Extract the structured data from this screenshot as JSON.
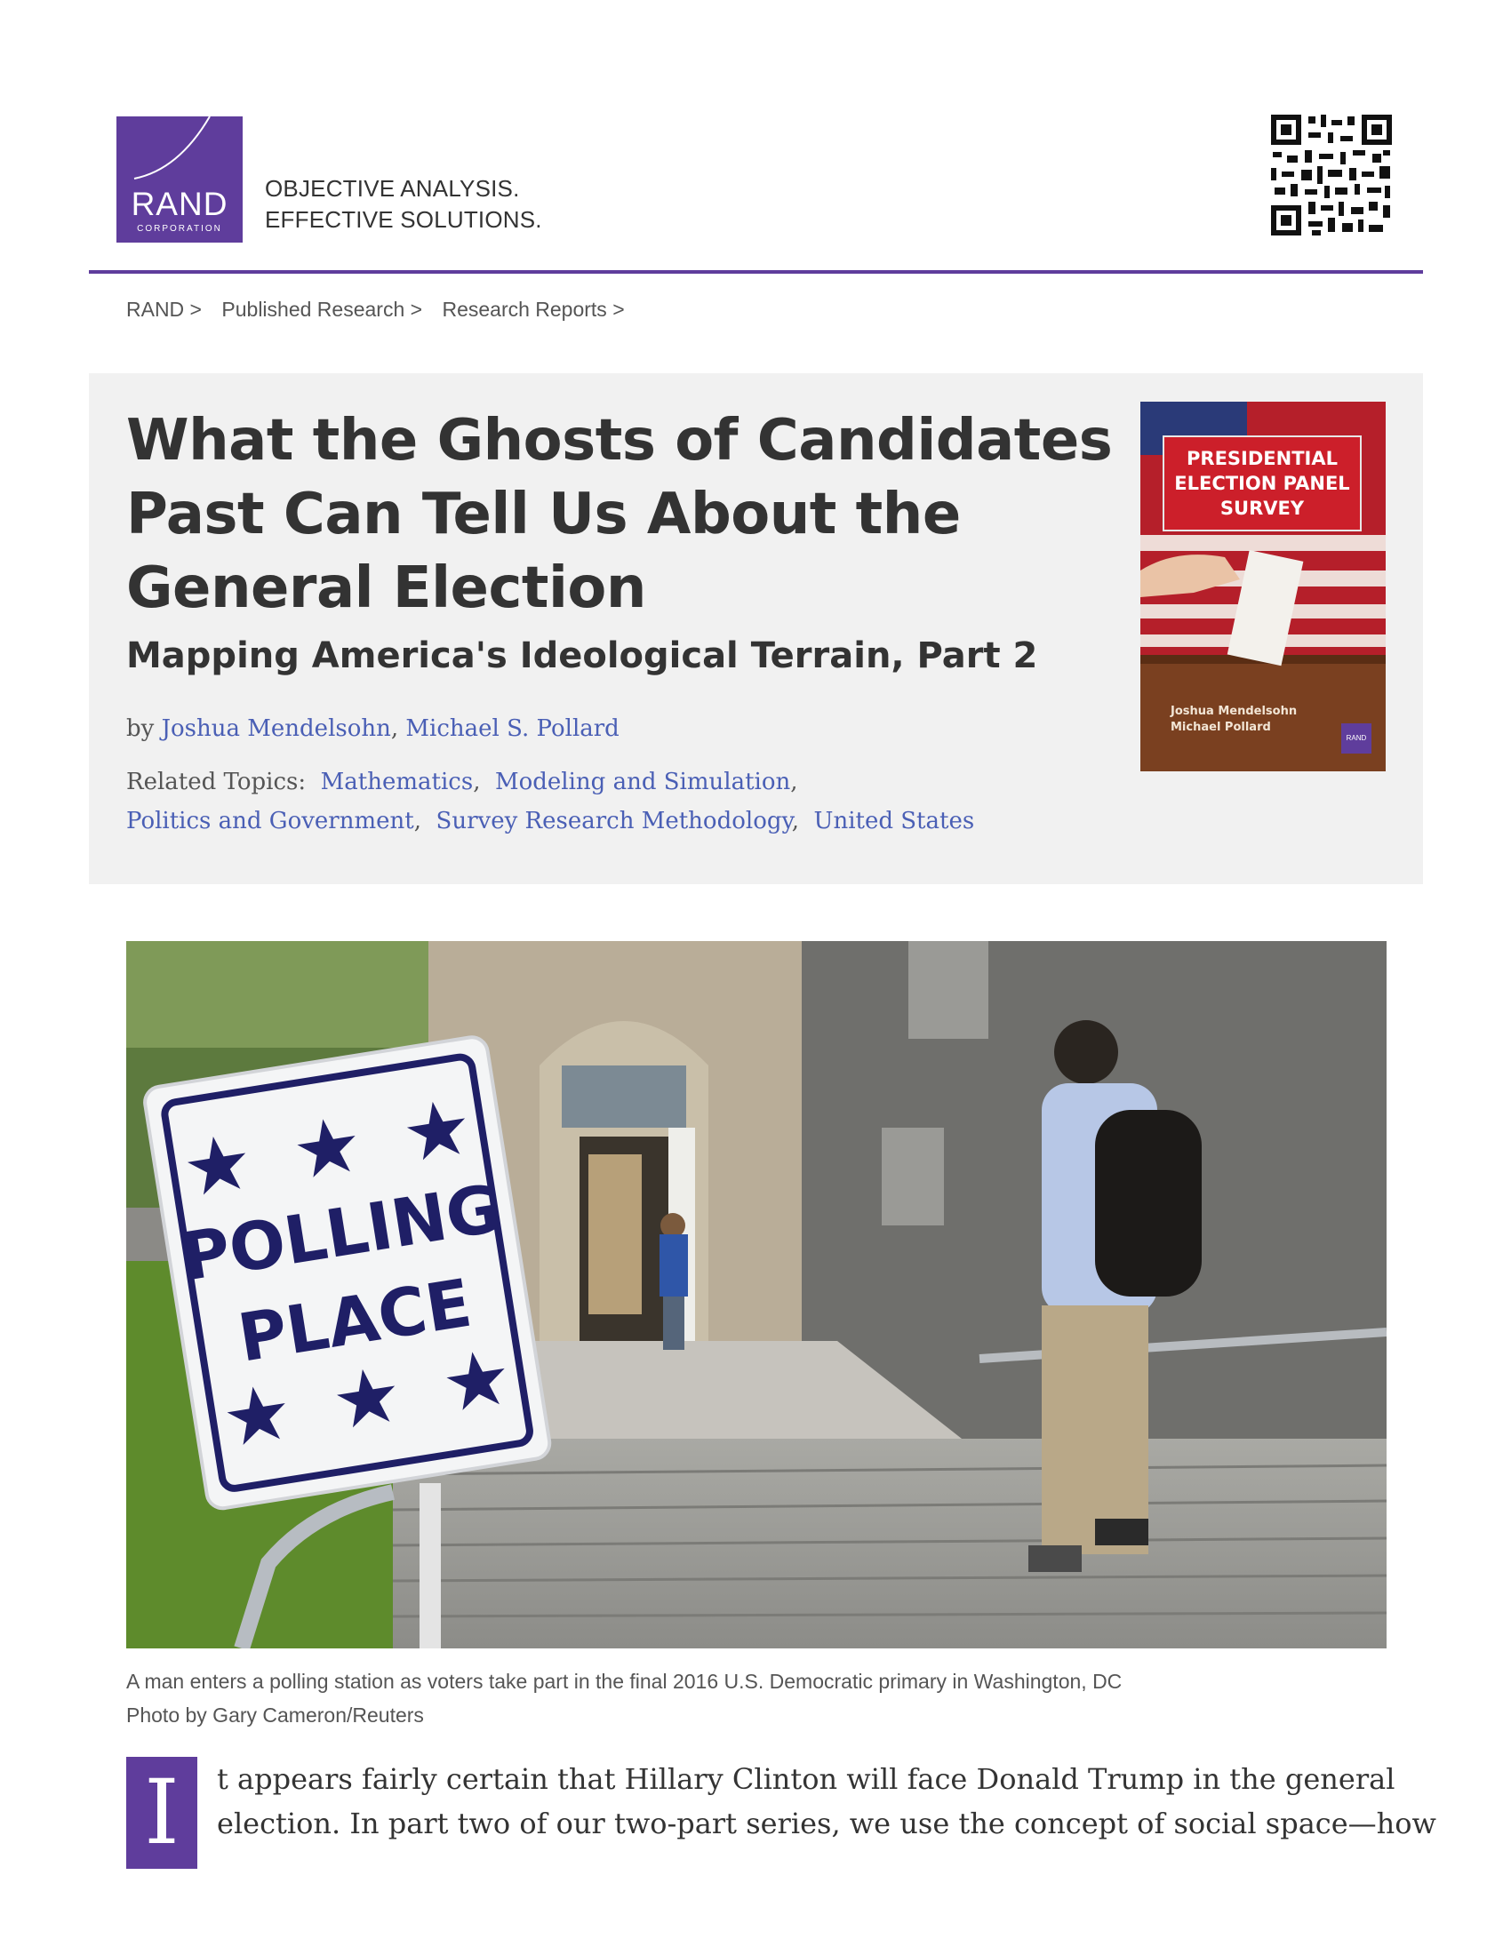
{
  "header": {
    "logo": {
      "name": "RAND",
      "sub": "CORPORATION"
    },
    "tagline": [
      "OBJECTIVE ANALYSIS.",
      "EFFECTIVE SOLUTIONS."
    ],
    "accent_color": "#5f3d9c"
  },
  "breadcrumb": [
    "RAND >",
    "Published Research >",
    "Research Reports >"
  ],
  "report": {
    "title": "What the Ghosts of Candidates Past Can Tell Us About the General Election",
    "subtitle": "Mapping America's Ideological Terrain, Part 2",
    "by_label": "by",
    "authors": [
      "Joshua Mendelsohn",
      "Michael S. Pollard"
    ],
    "related_label": "Related Topics:",
    "topics": [
      "Mathematics",
      "Modeling and Simulation",
      "Politics and Government",
      "Survey Research Methodology",
      "United States"
    ],
    "cover": {
      "label": "PRESIDENTIAL ELECTION PANEL SURVEY",
      "authors": [
        "Joshua Mendelsohn",
        "Michael Pollard"
      ],
      "logo": "RAND"
    }
  },
  "photo": {
    "sign_top": "POLLING",
    "sign_bottom": "PLACE",
    "caption": "A man enters a polling station as voters take part in the final 2016 U.S. Democratic primary in Washington, DC",
    "credit": "Photo by Gary Cameron/Reuters"
  },
  "body": {
    "drop_cap": "I",
    "lines": [
      "t appears fairly certain that Hillary Clinton will face Donald Trump in the general",
      "election. In part two of our two-part series, we use the concept of social space—how"
    ]
  }
}
